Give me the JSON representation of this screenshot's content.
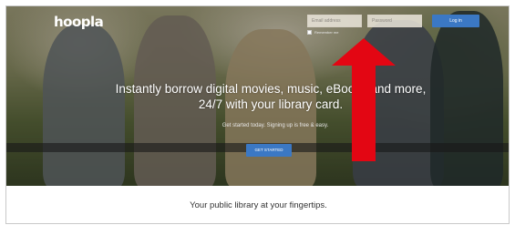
{
  "brand": {
    "logo_text": "hoopla"
  },
  "login": {
    "email_placeholder": "Email address",
    "password_placeholder": "Password",
    "remember_label": "Remember me",
    "login_button": "Log in"
  },
  "hero": {
    "headline": "Instantly borrow digital movies, music, eBooks and more, 24/7 with your library card.",
    "subtext": "Get started today. Signing up is free & easy.",
    "cta_button": "GET STARTED"
  },
  "annotation": {
    "arrow_color": "#e30613"
  },
  "colors": {
    "accent": "#3b78c4"
  },
  "tagline": "Your public library at your fingertips."
}
